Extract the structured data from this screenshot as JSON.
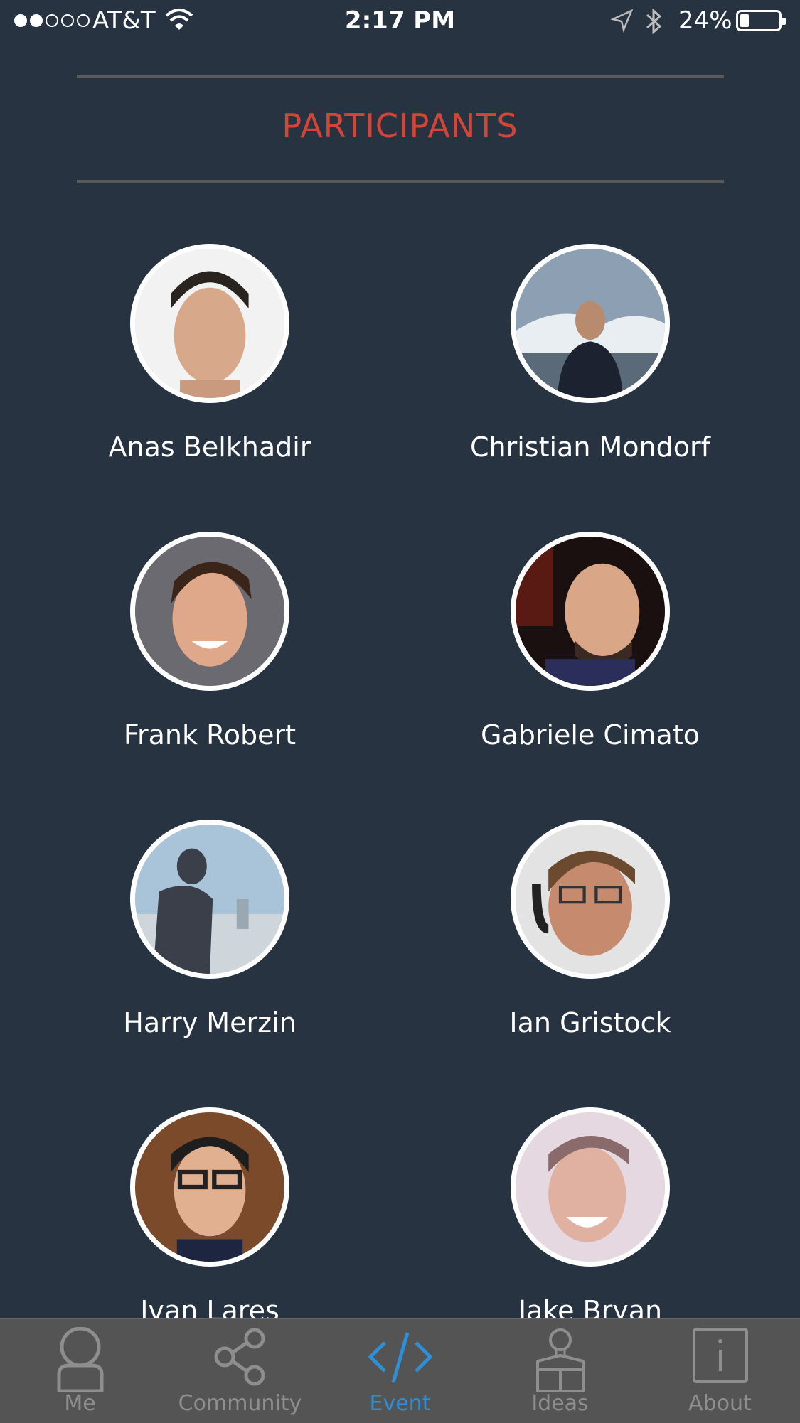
{
  "status_bar": {
    "carrier": "AT&T",
    "time": "2:17 PM",
    "battery_percent": "24%"
  },
  "section": {
    "title": "PARTICIPANTS"
  },
  "participants": [
    {
      "name": "Anas Belkhadir"
    },
    {
      "name": "Christian Mondorf"
    },
    {
      "name": "Frank Robert"
    },
    {
      "name": "Gabriele Cimato"
    },
    {
      "name": "Harry Merzin"
    },
    {
      "name": "Ian Gristock"
    },
    {
      "name": "Ivan Lares"
    },
    {
      "name": "Jake Bryan"
    }
  ],
  "tab_bar": {
    "tabs": [
      {
        "label": "Me",
        "icon": "person-icon"
      },
      {
        "label": "Community",
        "icon": "share-icon"
      },
      {
        "label": "Event",
        "icon": "code-icon"
      },
      {
        "label": "Ideas",
        "icon": "lightbulb-box-icon"
      },
      {
        "label": "About",
        "icon": "info-icon"
      }
    ],
    "active_tab": "Event",
    "active_color": "#2d8fd5",
    "inactive_color": "#8e8e8e"
  },
  "colors": {
    "background": "#273341",
    "accent": "#d2463a"
  }
}
